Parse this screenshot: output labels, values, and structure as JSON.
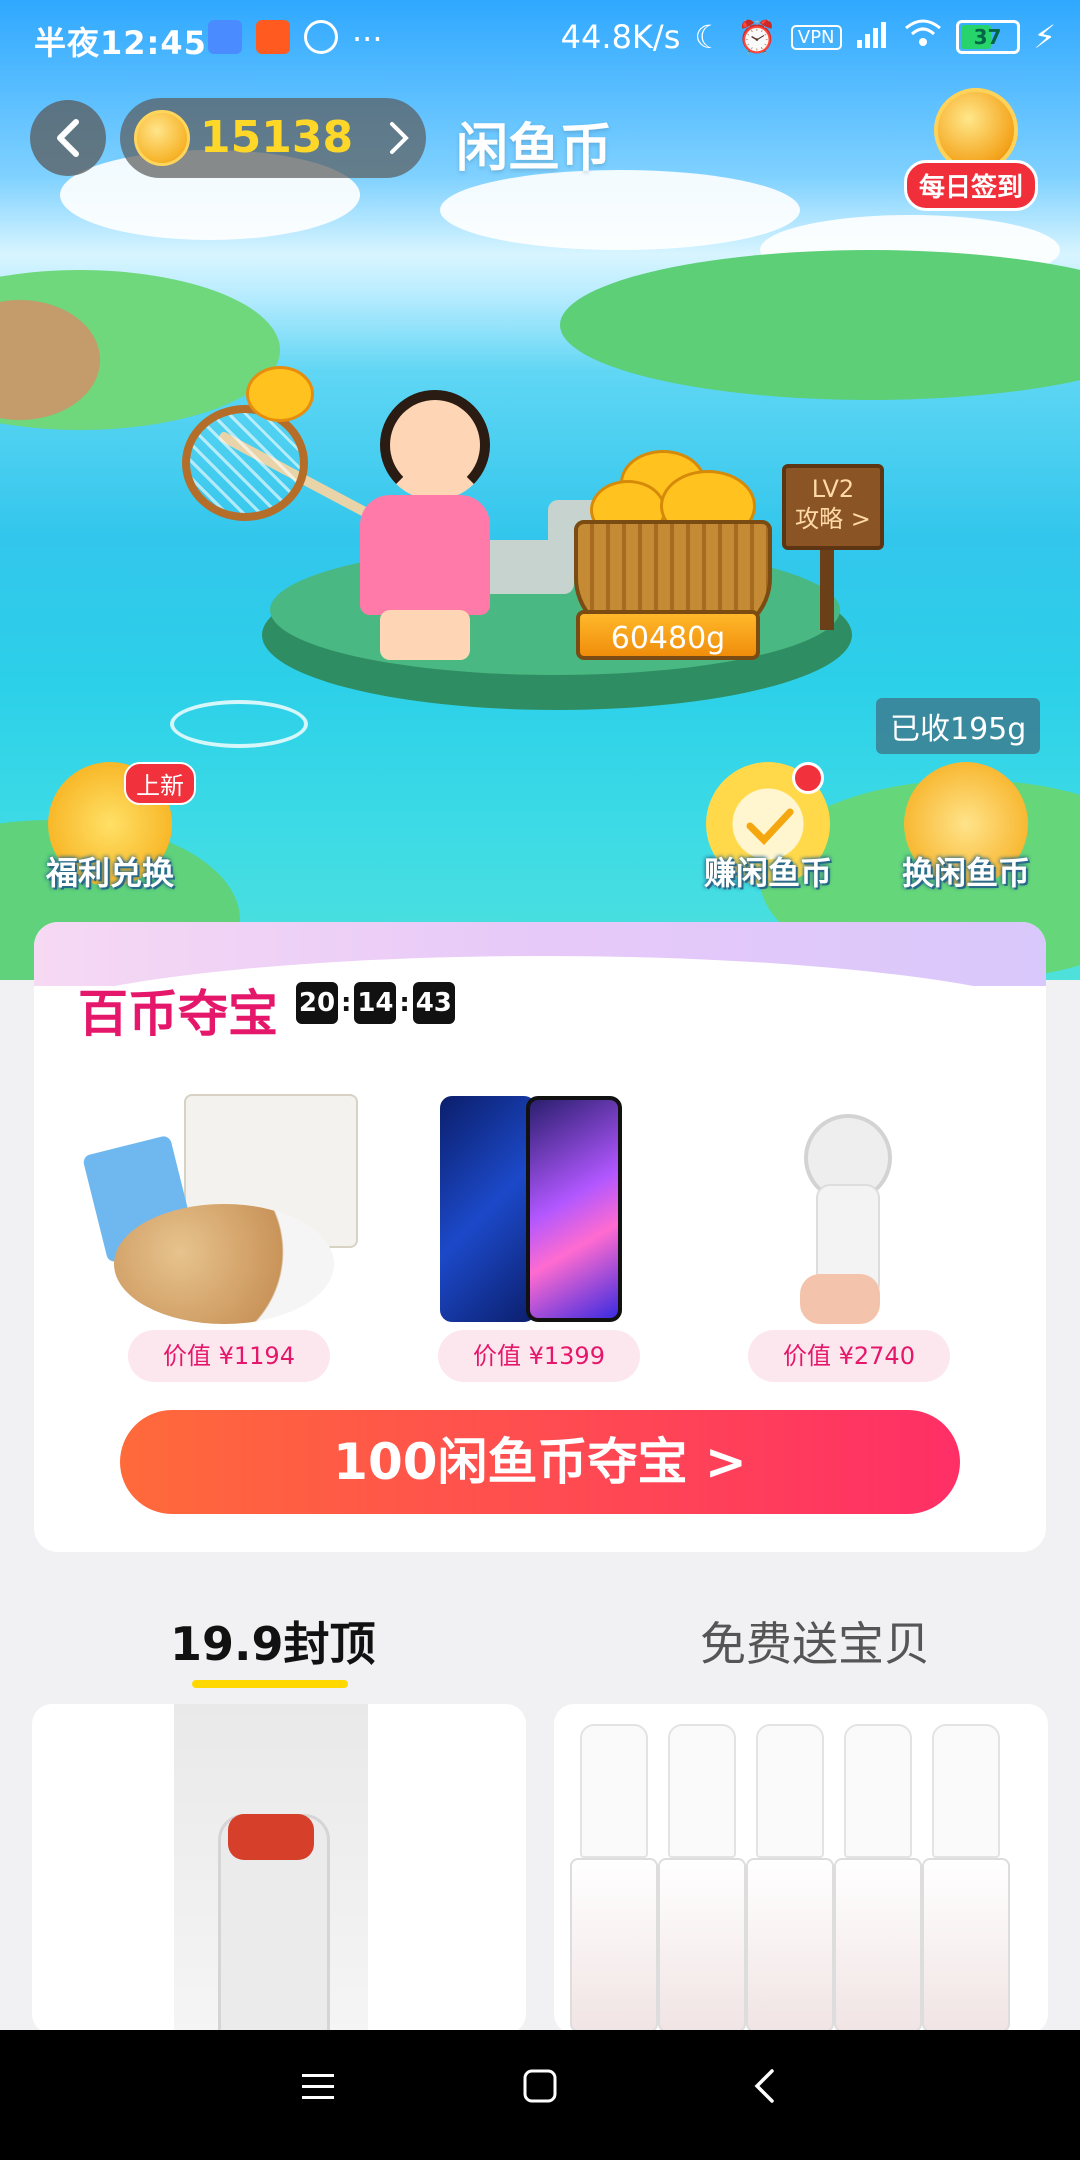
{
  "status_bar": {
    "time": "半夜12:45",
    "more": "···",
    "net_speed": "44.8K/s",
    "vpn": "VPN",
    "battery": "37"
  },
  "header": {
    "coin_balance": "15138",
    "title": "闲鱼币",
    "daily_signin": "每日签到"
  },
  "scene": {
    "sign_level": "LV2",
    "sign_guide": "攻略 >",
    "basket_weight": "60480g",
    "collected": "已收195g"
  },
  "actions": {
    "welfare": "福利兑换",
    "new_badge": "上新",
    "earn": "赚闲鱼币",
    "exchange": "换闲鱼币"
  },
  "treasure": {
    "title": "百币夺宝",
    "countdown": {
      "h": "20",
      "m": "14",
      "s": "43"
    },
    "products": [
      {
        "price": "价值 ¥1194",
        "name": "nuts-gift-box"
      },
      {
        "price": "价值 ¥1399",
        "name": "honor-phone"
      },
      {
        "price": "价值 ¥2740",
        "name": "face-cleansing-brush"
      }
    ],
    "cta": "100闲鱼币夺宝 >"
  },
  "tabs": {
    "active": "19.9封顶",
    "inactive": "免费送宝贝"
  },
  "colors": {
    "accent_pink": "#e5176b",
    "cta_start": "#ff6a3a",
    "cta_end": "#ff2f66",
    "coin_yellow": "#ffd728",
    "tab_underline": "#ffd800"
  }
}
